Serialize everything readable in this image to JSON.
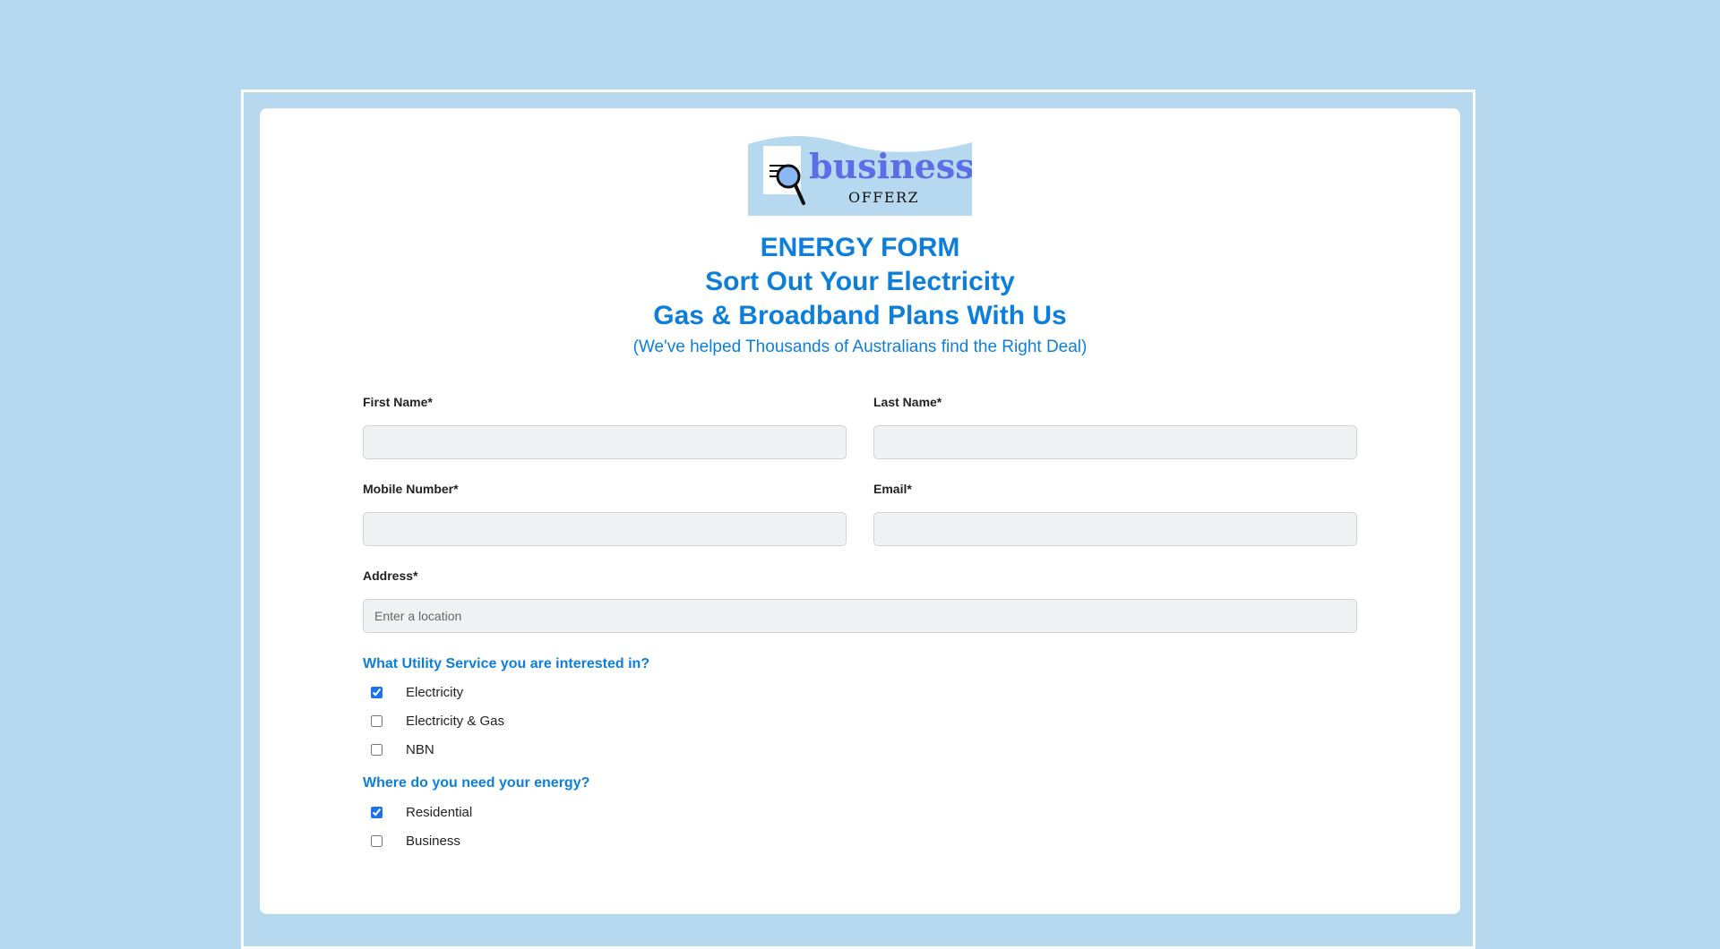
{
  "brand": {
    "name": "business",
    "tagline": "OFFERZ"
  },
  "header": {
    "line1": "ENERGY FORM",
    "line2": "Sort Out Your Electricity",
    "line3": "Gas & Broadband Plans With Us",
    "subline": "(We've helped Thousands of Australians find the Right Deal)"
  },
  "form": {
    "first_name_label": "First Name*",
    "last_name_label": "Last Name*",
    "mobile_label": "Mobile Number*",
    "email_label": "Email*",
    "address_label": "Address*",
    "address_placeholder": "Enter a location"
  },
  "services": {
    "title": "What Utility Service you are interested in?",
    "options": [
      {
        "label": "Electricity",
        "checked": true
      },
      {
        "label": "Electricity & Gas",
        "checked": false
      },
      {
        "label": "NBN",
        "checked": false
      }
    ]
  },
  "location": {
    "title": "Where do you need your energy?",
    "options": [
      {
        "label": "Residential",
        "checked": true
      },
      {
        "label": "Business",
        "checked": false
      }
    ]
  },
  "colors": {
    "background": "#b6d9f0",
    "accent": "#0d7fdb",
    "logo_purple": "#5b6ee8"
  }
}
